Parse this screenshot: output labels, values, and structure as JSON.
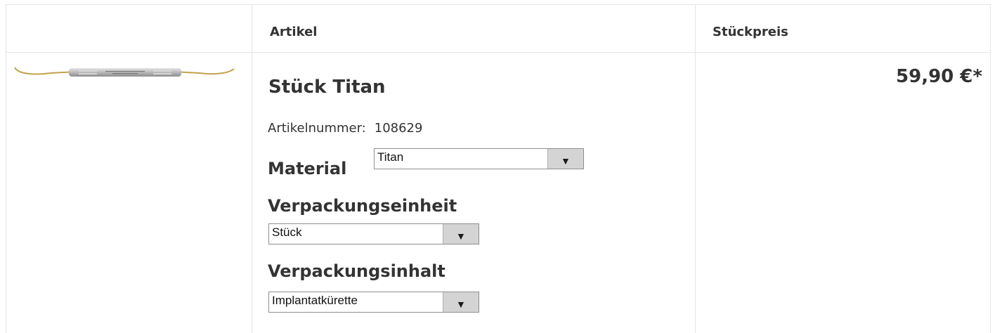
{
  "table": {
    "headers": {
      "image": "",
      "article": "Artikel",
      "unit_price": "Stückpreis"
    }
  },
  "product": {
    "image_icon": "dental-instrument-image",
    "title": "Stück Titan",
    "article_number_label": "Artikelnummer:",
    "article_number": "108629",
    "price": "59,90 €*",
    "options": {
      "material": {
        "label": "Material",
        "selected": "Titan"
      },
      "packaging_unit": {
        "label": "Verpackungseinheit",
        "selected": "Stück"
      },
      "packaging_content": {
        "label": "Verpackungsinhalt",
        "selected": "Implantatkürette"
      }
    }
  },
  "colors": {
    "border": "#e6e6e6",
    "text": "#333333",
    "select_button": "#d4d4d4"
  }
}
